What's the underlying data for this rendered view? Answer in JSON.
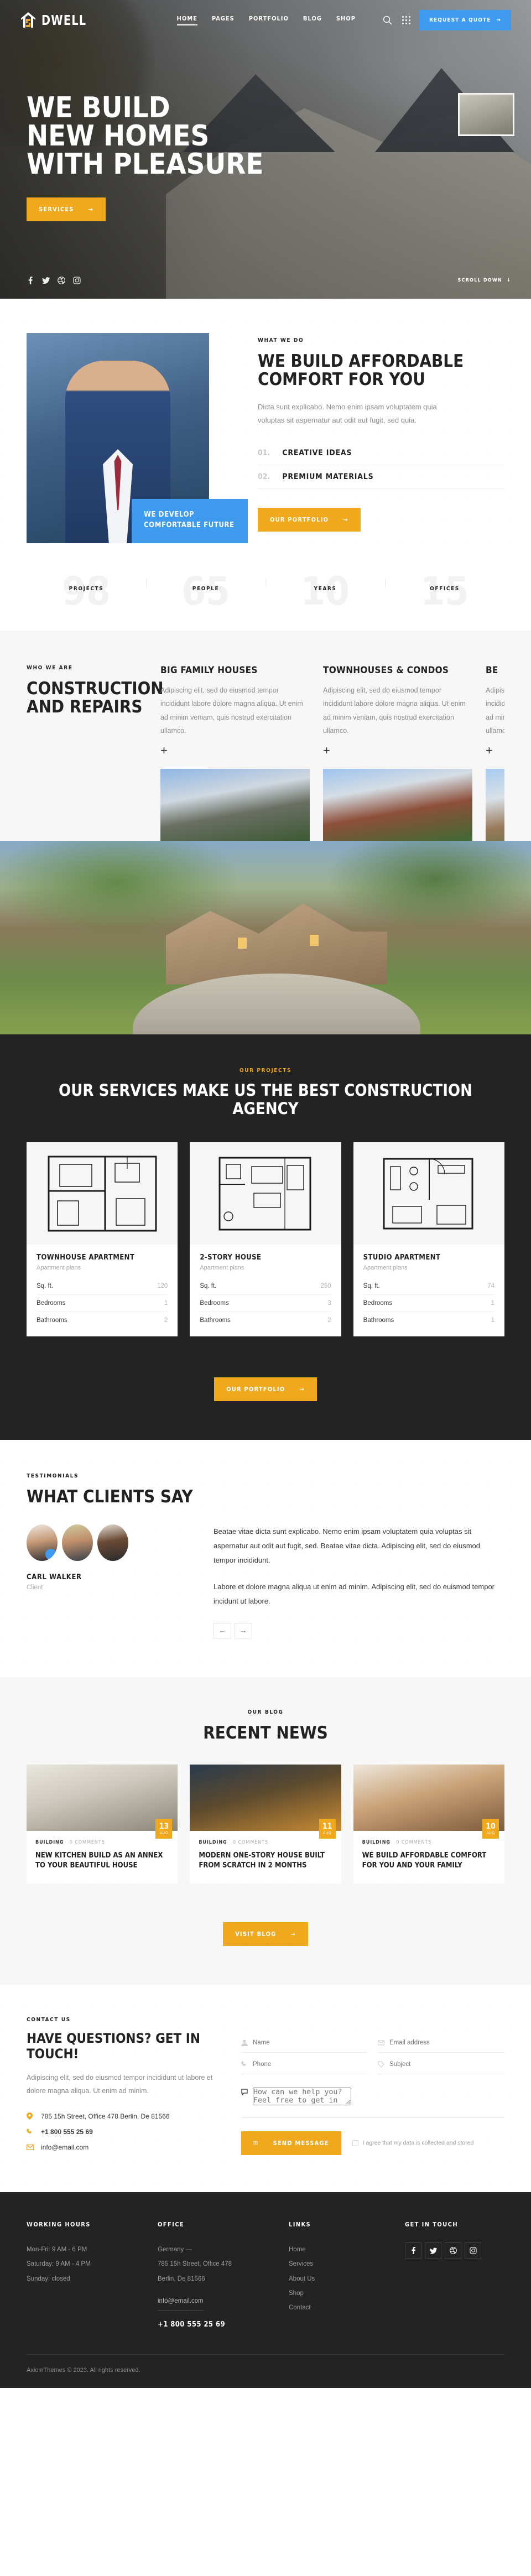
{
  "header": {
    "brand": "DWELL",
    "nav": [
      {
        "label": "HOME",
        "active": true
      },
      {
        "label": "PAGES",
        "active": false
      },
      {
        "label": "PORTFOLIO",
        "active": false
      },
      {
        "label": "BLOG",
        "active": false
      },
      {
        "label": "SHOP",
        "active": false
      }
    ],
    "search_icon": "search-icon",
    "grid_icon": "grid-menu-icon",
    "quote_button": "REQUEST A QUOTE"
  },
  "hero": {
    "line1": "WE BUILD",
    "line2": "NEW HOMES",
    "line3": "WITH PLEASURE",
    "cta": "SERVICES",
    "scroll": "SCROLL DOWN",
    "socials": [
      "facebook-icon",
      "twitter-icon",
      "dribbble-icon",
      "instagram-icon"
    ]
  },
  "what_we_do": {
    "eyebrow": "WHAT WE DO",
    "title": "WE BUILD AFFORDABLE COMFORT FOR YOU",
    "text": "Dicta sunt explicabo. Nemo enim ipsam voluptatem quia voluptas sit aspernatur aut odit aut fugit, sed quia.",
    "badge": "WE DEVELOP COMFORTABLE FUTURE",
    "items": [
      {
        "num": "01.",
        "label": "CREATIVE IDEAS"
      },
      {
        "num": "02.",
        "label": "PREMIUM MATERIALS"
      }
    ],
    "cta": "OUR PORTFOLIO"
  },
  "counters": [
    {
      "value": "98",
      "label": "PROJECTS"
    },
    {
      "value": "65",
      "label": "PEOPLE"
    },
    {
      "value": "10",
      "label": "YEARS"
    },
    {
      "value": "15",
      "label": "OFFICES"
    }
  ],
  "who_we_are": {
    "eyebrow": "WHO WE ARE",
    "title": "CONSTRUCTION AND REPAIRS",
    "cards": [
      {
        "title": "BIG FAMILY HOUSES",
        "text": "Adipiscing elit, sed do eiusmod tempor incididunt labore dolore magna aliqua. Ut enim ad minim veniam, quis nostrud exercitation ullamco.",
        "plus": "+"
      },
      {
        "title": "TOWNHOUSES & CONDOS",
        "text": "Adipiscing elit, sed do eiusmod tempor incididunt labore dolore magna aliqua. Ut enim ad minim veniam, quis nostrud exercitation ullamco.",
        "plus": "+"
      },
      {
        "title": "BE",
        "text": "Adipiscing elit, sed do eiusmod tempor incididunt labore dolore magna aliqua. Ut enim ad minim veniam, quis nostrud exercitation ullamco.",
        "plus": "+"
      }
    ]
  },
  "projects": {
    "eyebrow": "OUR PROJECTS",
    "title": "OUR SERVICES MAKE US THE BEST CONSTRUCTION AGENCY",
    "cta": "OUR PORTFOLIO",
    "spec_labels": {
      "sqft": "Sq. ft.",
      "bedrooms": "Bedrooms",
      "bathrooms": "Bathrooms"
    },
    "cards": [
      {
        "title": "TOWNHOUSE APARTMENT",
        "sub": "Apartment plans",
        "sqft": "120",
        "bedrooms": "1",
        "bathrooms": "2"
      },
      {
        "title": "2-STORY HOUSE",
        "sub": "Apartment plans",
        "sqft": "250",
        "bedrooms": "3",
        "bathrooms": "2"
      },
      {
        "title": "STUDIO APARTMENT",
        "sub": "Apartment plans",
        "sqft": "74",
        "bedrooms": "1",
        "bathrooms": "1"
      }
    ]
  },
  "testimonials": {
    "eyebrow": "TESTIMONIALS",
    "title": "WHAT CLIENTS SAY",
    "name": "CARL WALKER",
    "role": "Client",
    "quote_icon": "quote-icon",
    "para1": "Beatae vitae dicta sunt explicabo. Nemo enim ipsam voluptatem quia voluptas sit aspernatur aut odit aut fugit, sed. Beatae vitae dicta. Adipiscing elit, sed do eiusmod tempor incididunt.",
    "para2": "Labore et dolore magna aliqua ut enim ad minim. Adipiscing elit, sed do euismod tempor incidunt ut labore.",
    "prev": "←",
    "next": "→"
  },
  "news": {
    "eyebrow": "OUR BLOG",
    "title": "RECENT NEWS",
    "cta": "VISIT BLOG",
    "cards": [
      {
        "day": "13",
        "month": "AUG",
        "category": "BUILDING",
        "comments": "0 Comments",
        "title": "NEW KITCHEN BUILD AS AN ANNEX TO YOUR BEAUTIFUL HOUSE"
      },
      {
        "day": "11",
        "month": "AUG",
        "category": "BUILDING",
        "comments": "0 Comments",
        "title": "MODERN ONE-STORY HOUSE BUILT FROM SCRATCH IN 2 MONTHS"
      },
      {
        "day": "10",
        "month": "AUG",
        "category": "BUILDING",
        "comments": "0 Comments",
        "title": "WE BUILD AFFORDABLE COMFORT FOR YOU AND YOUR FAMILY"
      }
    ]
  },
  "contact": {
    "eyebrow": "CONTACT US",
    "title": "HAVE QUESTIONS? GET IN TOUCH!",
    "text": "Adipiscing elit, sed do eiusmod tempor incididunt ut labore et dolore magna aliqua. Ut enim ad minim.",
    "address": "785 15h Street, Office 478 Berlin, De 81566",
    "phone": "+1 800 555 25 69",
    "email": "info@email.com",
    "form": {
      "name_placeholder": "Name",
      "email_placeholder": "Email address",
      "phone_placeholder": "Phone",
      "subject_placeholder": "Subject",
      "message_placeholder": "How can we help you? Feel free to get in touch!",
      "submit": "SEND MESSAGE",
      "consent": "I agree that my data is collected and stored"
    }
  },
  "footer": {
    "working_hours": {
      "heading": "WORKING HOURS",
      "lines": [
        "Mon-Fri: 9 AM - 6 PM",
        "Saturday: 9 AM - 4 PM",
        "Sunday: closed"
      ]
    },
    "office": {
      "heading": "OFFICE",
      "lines": [
        "Germany —",
        "785 15h Street, Office 478",
        "Berlin, De 81566"
      ],
      "email": "info@email.com",
      "phone": "+1 800 555 25 69"
    },
    "links": {
      "heading": "LINKS",
      "items": [
        "Home",
        "Services",
        "About Us",
        "Shop",
        "Contact"
      ]
    },
    "get_in_touch": {
      "heading": "GET IN TOUCH",
      "socials": [
        "facebook-icon",
        "twitter-icon",
        "dribbble-icon",
        "instagram-icon"
      ]
    },
    "copyright": "AxiomThemes © 2023. All rights reserved."
  }
}
